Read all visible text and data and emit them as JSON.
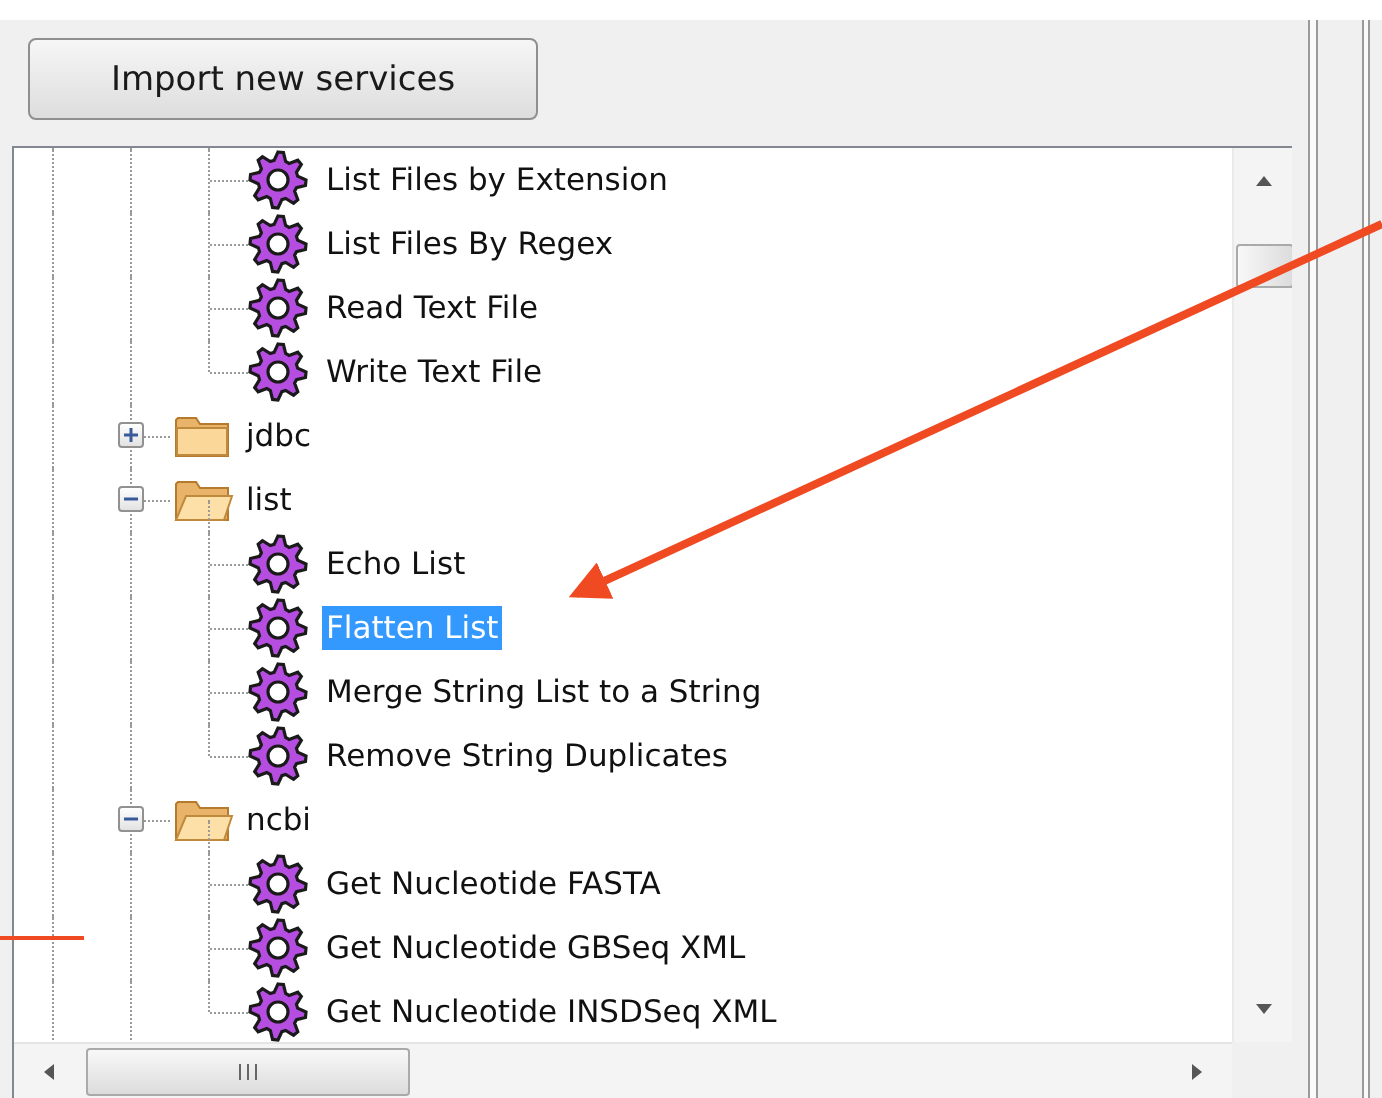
{
  "toolbar": {
    "import_button": "Import new services"
  },
  "tree": [
    {
      "kind": "continuation",
      "children": [
        {
          "label": "List Files by Extension",
          "selected": false
        },
        {
          "label": "List Files By Regex",
          "selected": false
        },
        {
          "label": "Read Text File",
          "selected": false
        },
        {
          "label": "Write Text File",
          "selected": false
        }
      ]
    },
    {
      "kind": "folder",
      "label": "jdbc",
      "expanded": false,
      "selected": false
    },
    {
      "kind": "folder",
      "label": "list",
      "expanded": true,
      "selected": false,
      "children": [
        {
          "label": "Echo List",
          "selected": false
        },
        {
          "label": "Flatten List",
          "selected": true
        },
        {
          "label": "Merge String List to a String",
          "selected": false
        },
        {
          "label": "Remove String Duplicates",
          "selected": false
        }
      ]
    },
    {
      "kind": "folder",
      "label": "ncbi",
      "expanded": true,
      "selected": false,
      "children": [
        {
          "label": "Get Nucleotide FASTA",
          "selected": false
        },
        {
          "label": "Get Nucleotide GBSeq XML",
          "selected": false
        },
        {
          "label": "Get Nucleotide INSDSeq XML",
          "selected": false
        }
      ]
    }
  ]
}
